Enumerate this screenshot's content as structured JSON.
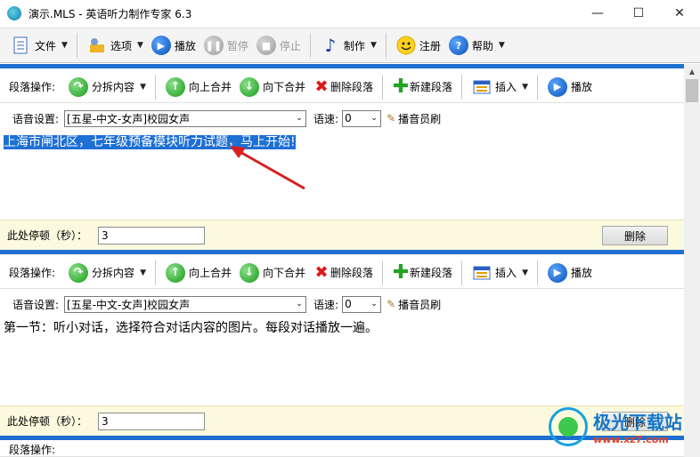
{
  "window": {
    "title": "演示.MLS - 英语听力制作专家 6.3"
  },
  "toolbar": {
    "file": "文件",
    "options": "选项",
    "play": "播放",
    "pause": "暂停",
    "stop": "停止",
    "make": "制作",
    "register": "注册",
    "help": "帮助"
  },
  "segment_toolbar": {
    "label": "段落操作:",
    "split": "分拆内容",
    "merge_up": "向上合并",
    "merge_down": "向下合并",
    "delete_para": "删除段落",
    "new_para": "新建段落",
    "insert": "插入",
    "play": "播放"
  },
  "voice": {
    "label": "语音设置:",
    "speed_label": "语速:",
    "brush": "播音员刷"
  },
  "segments": [
    {
      "voice": "[五星-中文-女声]校园女声",
      "speed": "0",
      "text": "上海市闸北区，七年级预备模块听力试题，马上开始!",
      "pause_label": "此处停顿（秒）：",
      "pause": "3",
      "delete": "删除"
    },
    {
      "voice": "[五星-中文-女声]校园女声",
      "speed": "0",
      "text": "第一节：听小对话，选择符合对话内容的图片。每段对话播放一遍。",
      "pause_label": "此处停顿（秒）：",
      "pause": "3",
      "delete": "删除"
    }
  ],
  "watermark": {
    "title": "极光下载站",
    "url": "www.xz7.com"
  },
  "colors": {
    "accent": "#1f6fd0",
    "pause_bg": "#fbf9de",
    "selection": "#1e6fd4"
  }
}
